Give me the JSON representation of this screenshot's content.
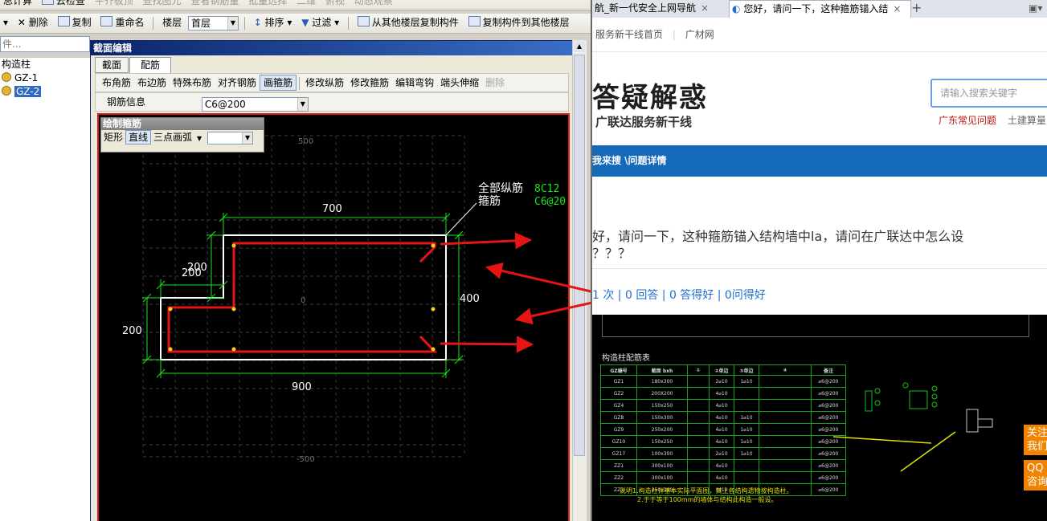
{
  "left_app": {
    "toolbar1": {
      "items": [
        "总计算",
        "云检查",
        "平齐板顶",
        "查找图元",
        "查看钢筋量",
        "批量选择",
        "二维",
        "俯视",
        "动态观察"
      ]
    },
    "toolbar2": {
      "delete": "删除",
      "copy": "复制",
      "rename": "重命名",
      "floor_label": "楼层",
      "floor_value": "首层",
      "sort": "排序",
      "filter": "过滤",
      "copy_from": "从其他楼层复制构件",
      "copy_to": "复制构件到其他楼层"
    },
    "search_placeholder": "件...",
    "tree": {
      "root": "构造柱",
      "items": [
        "GZ-1",
        "GZ-2"
      ]
    }
  },
  "dialog": {
    "title": "截面编辑",
    "tabs": [
      "截面",
      "配筋"
    ],
    "ribbon": [
      "布角筋",
      "布边筋",
      "特殊布筋",
      "对齐钢筋",
      "画箍筋",
      "修改纵筋",
      "修改箍筋",
      "编辑弯钩",
      "端头伸缩",
      "删除"
    ],
    "rebar_info_label": "钢筋信息",
    "rebar_info_value": "C6@200",
    "draw_panel": {
      "title": "绘制箍筋",
      "items": [
        "矩形",
        "直线",
        "三点画弧"
      ]
    },
    "drawing": {
      "dims": {
        "top": "700",
        "bottom": "900",
        "right": "400",
        "left": "200",
        "step_a": "200",
        "step_b": "200",
        "grid_top": "500",
        "grid_center": "0",
        "grid_bottom": "-500"
      },
      "callout": {
        "line1": "全部纵筋",
        "line2": "箍筋",
        "value1": "8C12",
        "value2": "C6@20"
      }
    },
    "colors": {
      "canvas": "#000000",
      "dim": "#19e619",
      "stirrup": "#e81414",
      "outline": "#ffffff",
      "frame": "#d41d1d"
    }
  },
  "browser": {
    "tabs": [
      {
        "label": "航_新一代安全上网导航"
      },
      {
        "label": "您好，请问一下，这种箍筋锚入结"
      }
    ],
    "bookmarks": [
      "服务新干线首页",
      "广材网"
    ],
    "logo": {
      "title": "答疑解惑",
      "subtitle": "广联达服务新干线"
    },
    "search_placeholder": "请输入搜索关键字",
    "links": [
      "广东常见问题",
      "土建算量"
    ],
    "breadcrumb": "我来搜 \\问题详情",
    "question_line1": "好，请问一下，这种箍筋锚入结构墙中la，请问在广联达中怎么设",
    "question_line2": "？？？",
    "stats": "1 次 | 0 回答 | 0 答得好 | 0问得好",
    "side_buttons": [
      "关注",
      "我们",
      "QQ",
      "咨询"
    ],
    "cad_table": {
      "title": "构造柱配筋表",
      "headers": [
        "GZ编号",
        "截面 bxh",
        "①",
        "②单边",
        "③单边",
        "④",
        "备注"
      ],
      "rows": [
        [
          "GZ1",
          "180x300",
          "",
          "2⌀10",
          "1⌀10",
          "",
          "⌀6@200"
        ],
        [
          "GZ2",
          "200X200",
          "",
          "4⌀10",
          "",
          "",
          "⌀6@200"
        ],
        [
          "GZ4",
          "150x250",
          "",
          "4⌀10",
          "",
          "",
          "⌀6@200"
        ],
        [
          "GZ8",
          "150x300",
          "",
          "4⌀10",
          "1⌀10",
          "",
          "⌀6@200"
        ],
        [
          "GZ9",
          "250x200",
          "",
          "4⌀10",
          "1⌀10",
          "",
          "⌀6@200"
        ],
        [
          "GZ10",
          "150x250",
          "",
          "4⌀10",
          "1⌀10",
          "",
          "⌀6@200"
        ],
        [
          "GZ17",
          "100x300",
          "",
          "2⌀10",
          "1⌀10",
          "",
          "⌀6@200"
        ],
        [
          "ZZ1",
          "300x100",
          "",
          "4⌀10",
          "",
          "",
          "⌀6@200"
        ],
        [
          "ZZ2",
          "300x100",
          "",
          "4⌀10",
          "",
          "",
          "⌀6@200"
        ],
        [
          "ZZ3",
          "250x100",
          "",
          "4⌀10",
          "",
          "",
          "⌀6@200"
        ]
      ],
      "notes": [
        "说明1.构造柱详基本实际平面图，其上各结构遗物按构造柱。",
        "2.于于等于100mm的墙体与结构此构造一般设。"
      ]
    }
  }
}
